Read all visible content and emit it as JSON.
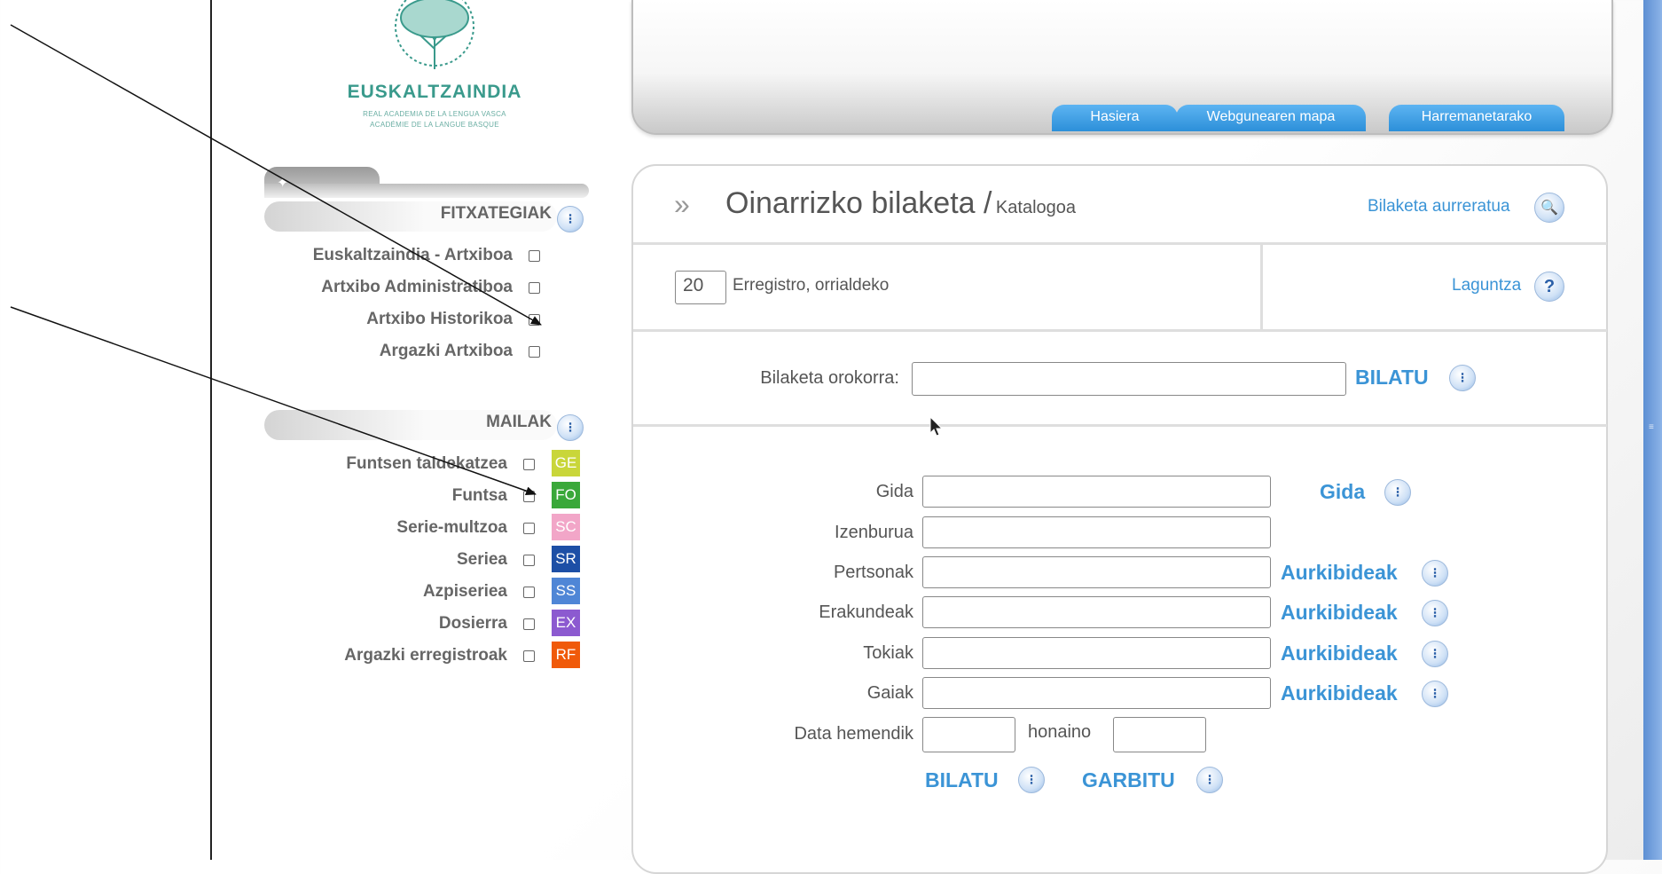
{
  "logo": {
    "name": "EUSKALTZAINDIA",
    "sub1": "REAL ACADEMIA DE LA LENGUA VASCA",
    "sub2": "ACADÉMIE DE LA LANGUE BASQUE"
  },
  "nav": {
    "tabs": [
      "Hasiera",
      "Webgunearen mapa",
      "Harremanetarako"
    ]
  },
  "sidebar": {
    "fitxategiak": {
      "title": "FITXATEGIAK",
      "items": [
        {
          "label": "Euskaltzaindia - Artxiboa",
          "checked": false
        },
        {
          "label": "Artxibo Administratiboa",
          "checked": false
        },
        {
          "label": "Artxibo Historikoa",
          "checked": false
        },
        {
          "label": "Argazki Artxiboa",
          "checked": false
        }
      ]
    },
    "mailak": {
      "title": "MAILAK",
      "items": [
        {
          "label": "Funtsen taldekatzea",
          "badge": "GE",
          "color": "#c9d63a",
          "checked": false
        },
        {
          "label": "Funtsa",
          "badge": "FO",
          "color": "#3aa83a",
          "checked": false
        },
        {
          "label": "Serie-multzoa",
          "badge": "SC",
          "color": "#f2a6c8",
          "checked": false
        },
        {
          "label": "Seriea",
          "badge": "SR",
          "color": "#1d4fa6",
          "checked": false
        },
        {
          "label": "Azpiseriea",
          "badge": "SS",
          "color": "#4f86d6",
          "checked": false
        },
        {
          "label": "Dosierra",
          "badge": "EX",
          "color": "#8c5ad0",
          "checked": false
        },
        {
          "label": "Argazki erregistroak",
          "badge": "RF",
          "color": "#f05a0a",
          "checked": false
        }
      ]
    }
  },
  "main": {
    "title": "Oinarrizko bilaketa /",
    "subtitle": "Katalogoa",
    "advanced_link": "Bilaketa aurreratua",
    "per_page_value": "20",
    "per_page_label": "Erregistro, orrialdeko",
    "help_link": "Laguntza",
    "general_search_label": "Bilaketa orokorra:",
    "general_search_button": "BILATU",
    "form": {
      "gida_label": "Gida",
      "gida_button": "Gida",
      "izenburua_label": "Izenburua",
      "pertsonak_label": "Pertsonak",
      "erakundeak_label": "Erakundeak",
      "tokiak_label": "Tokiak",
      "gaiak_label": "Gaiak",
      "aurkibideak": "Aurkibideak",
      "date_from_label": "Data hemendik",
      "date_to_label": "honaino",
      "search_button": "BILATU",
      "clear_button": "GARBITU"
    }
  },
  "icons": {
    "info": "info-dots-icon",
    "search": "magnifier-icon",
    "help": "question-icon",
    "chevron": "double-chevron-icon",
    "sidebar_tab": "sparkle-icon",
    "mouse": "mouse-pointer-icon"
  }
}
